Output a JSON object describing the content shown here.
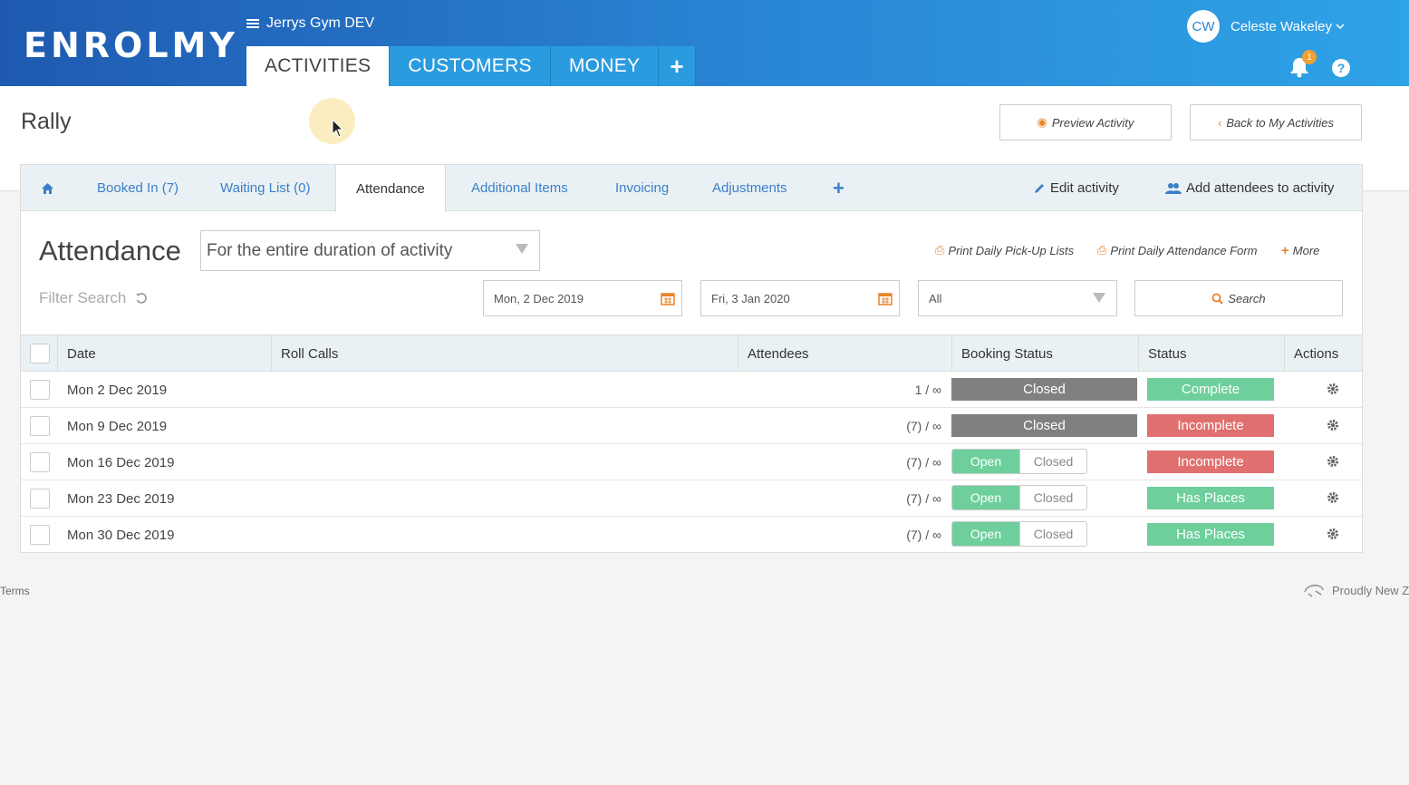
{
  "app": {
    "logo": "ENROLMY",
    "org_name": "Jerrys Gym DEV"
  },
  "nav": {
    "tabs": [
      {
        "label": "ACTIVITIES",
        "active": true
      },
      {
        "label": "CUSTOMERS",
        "active": false
      },
      {
        "label": "MONEY",
        "active": false
      }
    ],
    "add_label": "+"
  },
  "user": {
    "initials": "CW",
    "name": "Celeste Wakeley",
    "notifications": "1"
  },
  "page": {
    "title": "Rally",
    "preview_label": "Preview Activity",
    "back_label": "Back to My Activities"
  },
  "subtabs": {
    "booked": "Booked In (7)",
    "waiting": "Waiting List (0)",
    "attendance": "Attendance",
    "additional": "Additional Items",
    "invoicing": "Invoicing",
    "adjustments": "Adjustments",
    "edit": "Edit activity",
    "add_attendees": "Add attendees to activity"
  },
  "attendance": {
    "title": "Attendance",
    "duration": "For the entire duration of activity",
    "print_pickup": "Print Daily Pick-Up Lists",
    "print_form": "Print Daily Attendance Form",
    "more": "More",
    "filter_label": "Filter Search",
    "date_from": "Mon, 2 Dec 2019",
    "date_to": "Fri, 3 Jan 2020",
    "status_filter": "All",
    "search_label": "Search"
  },
  "table": {
    "headers": {
      "date": "Date",
      "roll_calls": "Roll Calls",
      "attendees": "Attendees",
      "booking_status": "Booking Status",
      "status": "Status",
      "actions": "Actions"
    },
    "rows": [
      {
        "date": "Mon 2 Dec 2019",
        "attendees": "1 / ∞",
        "booking": "Closed",
        "status": "Complete"
      },
      {
        "date": "Mon 9 Dec 2019",
        "attendees": "(7) / ∞",
        "booking": "Closed",
        "status": "Incomplete"
      },
      {
        "date": "Mon 16 Dec 2019",
        "attendees": "(7) / ∞",
        "booking_open": "Open",
        "booking_closed": "Closed",
        "status": "Incomplete"
      },
      {
        "date": "Mon 23 Dec 2019",
        "attendees": "(7) / ∞",
        "booking_open": "Open",
        "booking_closed": "Closed",
        "status": "Has Places"
      },
      {
        "date": "Mon 30 Dec 2019",
        "attendees": "(7) / ∞",
        "booking_open": "Open",
        "booking_closed": "Closed",
        "status": "Has Places"
      }
    ]
  },
  "footer": {
    "terms": "Terms",
    "nz": "Proudly New Ze"
  },
  "colors": {
    "brand": "#2a86d6",
    "green": "#6ecf9d",
    "red": "#e07070",
    "grey": "#808080",
    "orange": "#e8842c"
  }
}
